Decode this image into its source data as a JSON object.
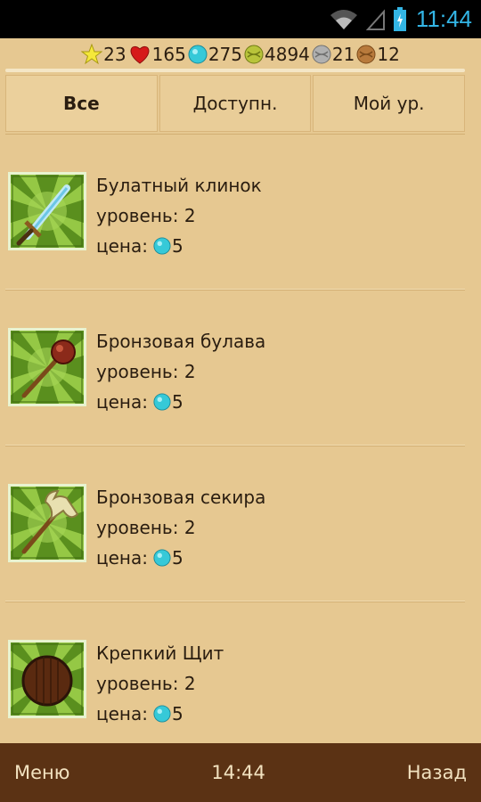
{
  "statusbar": {
    "time": "11:44"
  },
  "resources": [
    {
      "icon": "star-icon",
      "value": "23",
      "color": "#f5e83a"
    },
    {
      "icon": "heart-icon",
      "value": "165",
      "color": "#d61a1a"
    },
    {
      "icon": "cyan-gem-icon",
      "value": "275",
      "color": "#36c9d8"
    },
    {
      "icon": "gold-coin-icon",
      "value": "4894",
      "color": "#b8c43a"
    },
    {
      "icon": "silver-coin-icon",
      "value": "21",
      "color": "#b0b0b0"
    },
    {
      "icon": "copper-coin-icon",
      "value": "12",
      "color": "#b87a3c"
    }
  ],
  "tabs": [
    {
      "label": "Все",
      "active": true
    },
    {
      "label": "Доступн.",
      "active": false
    },
    {
      "label": "Мой ур.",
      "active": false
    }
  ],
  "items": [
    {
      "name": "Булатный клинок",
      "level": "уровень: 2",
      "price_label": "цена:",
      "price": "5",
      "icon": "sword-icon"
    },
    {
      "name": "Бронзовая булава",
      "level": "уровень: 2",
      "price_label": "цена:",
      "price": "5",
      "icon": "mace-icon"
    },
    {
      "name": "Бронзовая секира",
      "level": "уровень: 2",
      "price_label": "цена:",
      "price": "5",
      "icon": "axe-icon"
    },
    {
      "name": "Крепкий Щит",
      "level": "уровень: 2",
      "price_label": "цена:",
      "price": "5",
      "icon": "shield-icon"
    }
  ],
  "bottombar": {
    "menu_label": "Меню",
    "time": "14:44",
    "back_label": "Назад"
  }
}
